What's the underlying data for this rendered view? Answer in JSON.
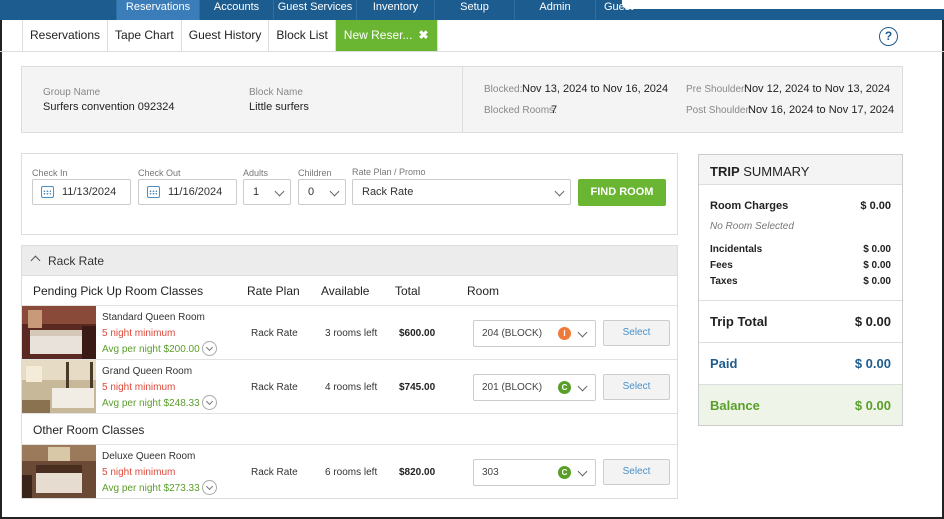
{
  "topnav": {
    "brand": "",
    "items": [
      {
        "label": "Reservations"
      },
      {
        "label": "Accounts"
      },
      {
        "label": "Guest Services"
      },
      {
        "label": "Inventory"
      },
      {
        "label": "Setup"
      },
      {
        "label": "Admin"
      },
      {
        "label": "Guest"
      }
    ]
  },
  "subtabs": [
    {
      "label": "Reservations"
    },
    {
      "label": "Tape Chart"
    },
    {
      "label": "Guest History"
    },
    {
      "label": "Block List"
    },
    {
      "label": "New Reser..."
    }
  ],
  "subtab_close_icon": "✖",
  "help_label": "?",
  "group": {
    "group_name_label": "Group Name",
    "group_name": "Surfers convention 092324",
    "block_name_label": "Block Name",
    "block_name": "Little surfers",
    "blocked_label": "Blocked:",
    "blocked": "Nov 13, 2024 to Nov 16, 2024",
    "blocked_rooms_label": "Blocked Rooms:",
    "blocked_rooms": "7",
    "pre_shoulder_label": "Pre Shoulder:",
    "pre_shoulder": "Nov 12, 2024 to Nov 13, 2024",
    "post_shoulder_label": "Post Shoulder:",
    "post_shoulder": "Nov 16, 2024 to Nov 17, 2024"
  },
  "search": {
    "check_in_label": "Check In",
    "check_in": "11/13/2024",
    "check_out_label": "Check Out",
    "check_out": "11/16/2024",
    "adults_label": "Adults",
    "adults": "1",
    "children_label": "Children",
    "children": "0",
    "rate_plan_label": "Rate Plan / Promo",
    "rate_plan": "Rack Rate",
    "find_button": "FIND ROOM"
  },
  "results": {
    "rate_header": "Rack Rate",
    "pending_title": "Pending Pick Up Room Classes",
    "col_rate_plan": "Rate Plan",
    "col_available": "Available",
    "col_total": "Total",
    "col_room": "Room",
    "other_title": "Other Room Classes",
    "rooms": [
      {
        "name": "Standard Queen Room",
        "minimum": "5 night minimum",
        "avg": "Avg per night $200.00",
        "rate_plan": "Rack Rate",
        "available": "3 rooms left",
        "total": "$600.00",
        "room": "204 (BLOCK)",
        "badge": "I",
        "badge_color": "#f07a3a",
        "select": "Select"
      },
      {
        "name": "Grand Queen Room",
        "minimum": "5 night minimum",
        "avg": "Avg per night $248.33",
        "rate_plan": "Rack Rate",
        "available": "4 rooms left",
        "total": "$745.00",
        "room": "201 (BLOCK)",
        "badge": "C",
        "badge_color": "#5a9e2a",
        "select": "Select"
      },
      {
        "name": "Deluxe Queen Room",
        "minimum": "5 night minimum",
        "avg": "Avg per night $273.33",
        "rate_plan": "Rack Rate",
        "available": "6 rooms left",
        "total": "$820.00",
        "room": "303",
        "badge": "C",
        "badge_color": "#5a9e2a",
        "select": "Select"
      }
    ]
  },
  "trip": {
    "title_bold": "TRIP",
    "title_rest": " SUMMARY",
    "room_charges_label": "Room Charges",
    "room_charges": "$ 0.00",
    "no_room": "No Room Selected",
    "incidentals_label": "Incidentals",
    "incidentals": "$ 0.00",
    "fees_label": "Fees",
    "fees": "$ 0.00",
    "taxes_label": "Taxes",
    "taxes": "$ 0.00",
    "trip_total_label": "Trip Total",
    "trip_total": "$ 0.00",
    "paid_label": "Paid",
    "paid": "$ 0.00",
    "balance_label": "Balance",
    "balance": "$ 0.00"
  },
  "colors": {
    "nav": "#1d5c8f",
    "accent_green": "#6ab531",
    "paid_blue": "#1d5c8f",
    "balance_green": "#5a9e2a",
    "min_red": "#e0483a"
  }
}
